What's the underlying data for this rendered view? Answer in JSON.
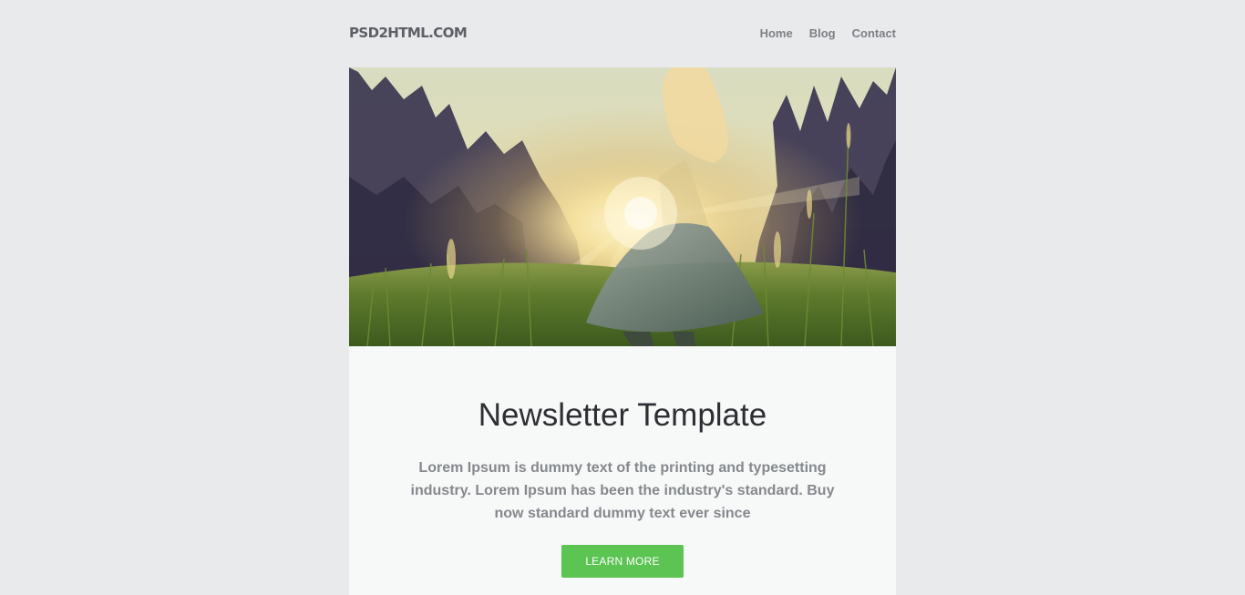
{
  "header": {
    "logo": "PSD2HTML.COM",
    "nav": [
      "Home",
      "Blog",
      "Contact"
    ]
  },
  "hero": {
    "image": "girl-in-sunlit-meadow-photo"
  },
  "content": {
    "title": "Newsletter Template",
    "body": "Lorem Ipsum is dummy text of the printing and typesetting industry. Lorem Ipsum has been the industry's standard. Buy now standard dummy text ever since",
    "button": "LEARN MORE"
  },
  "colors": {
    "background": "#e9eaec",
    "card": "#f7f8f8",
    "accent": "#5bc452",
    "title": "#2c2f33",
    "body_text": "#85898d"
  }
}
